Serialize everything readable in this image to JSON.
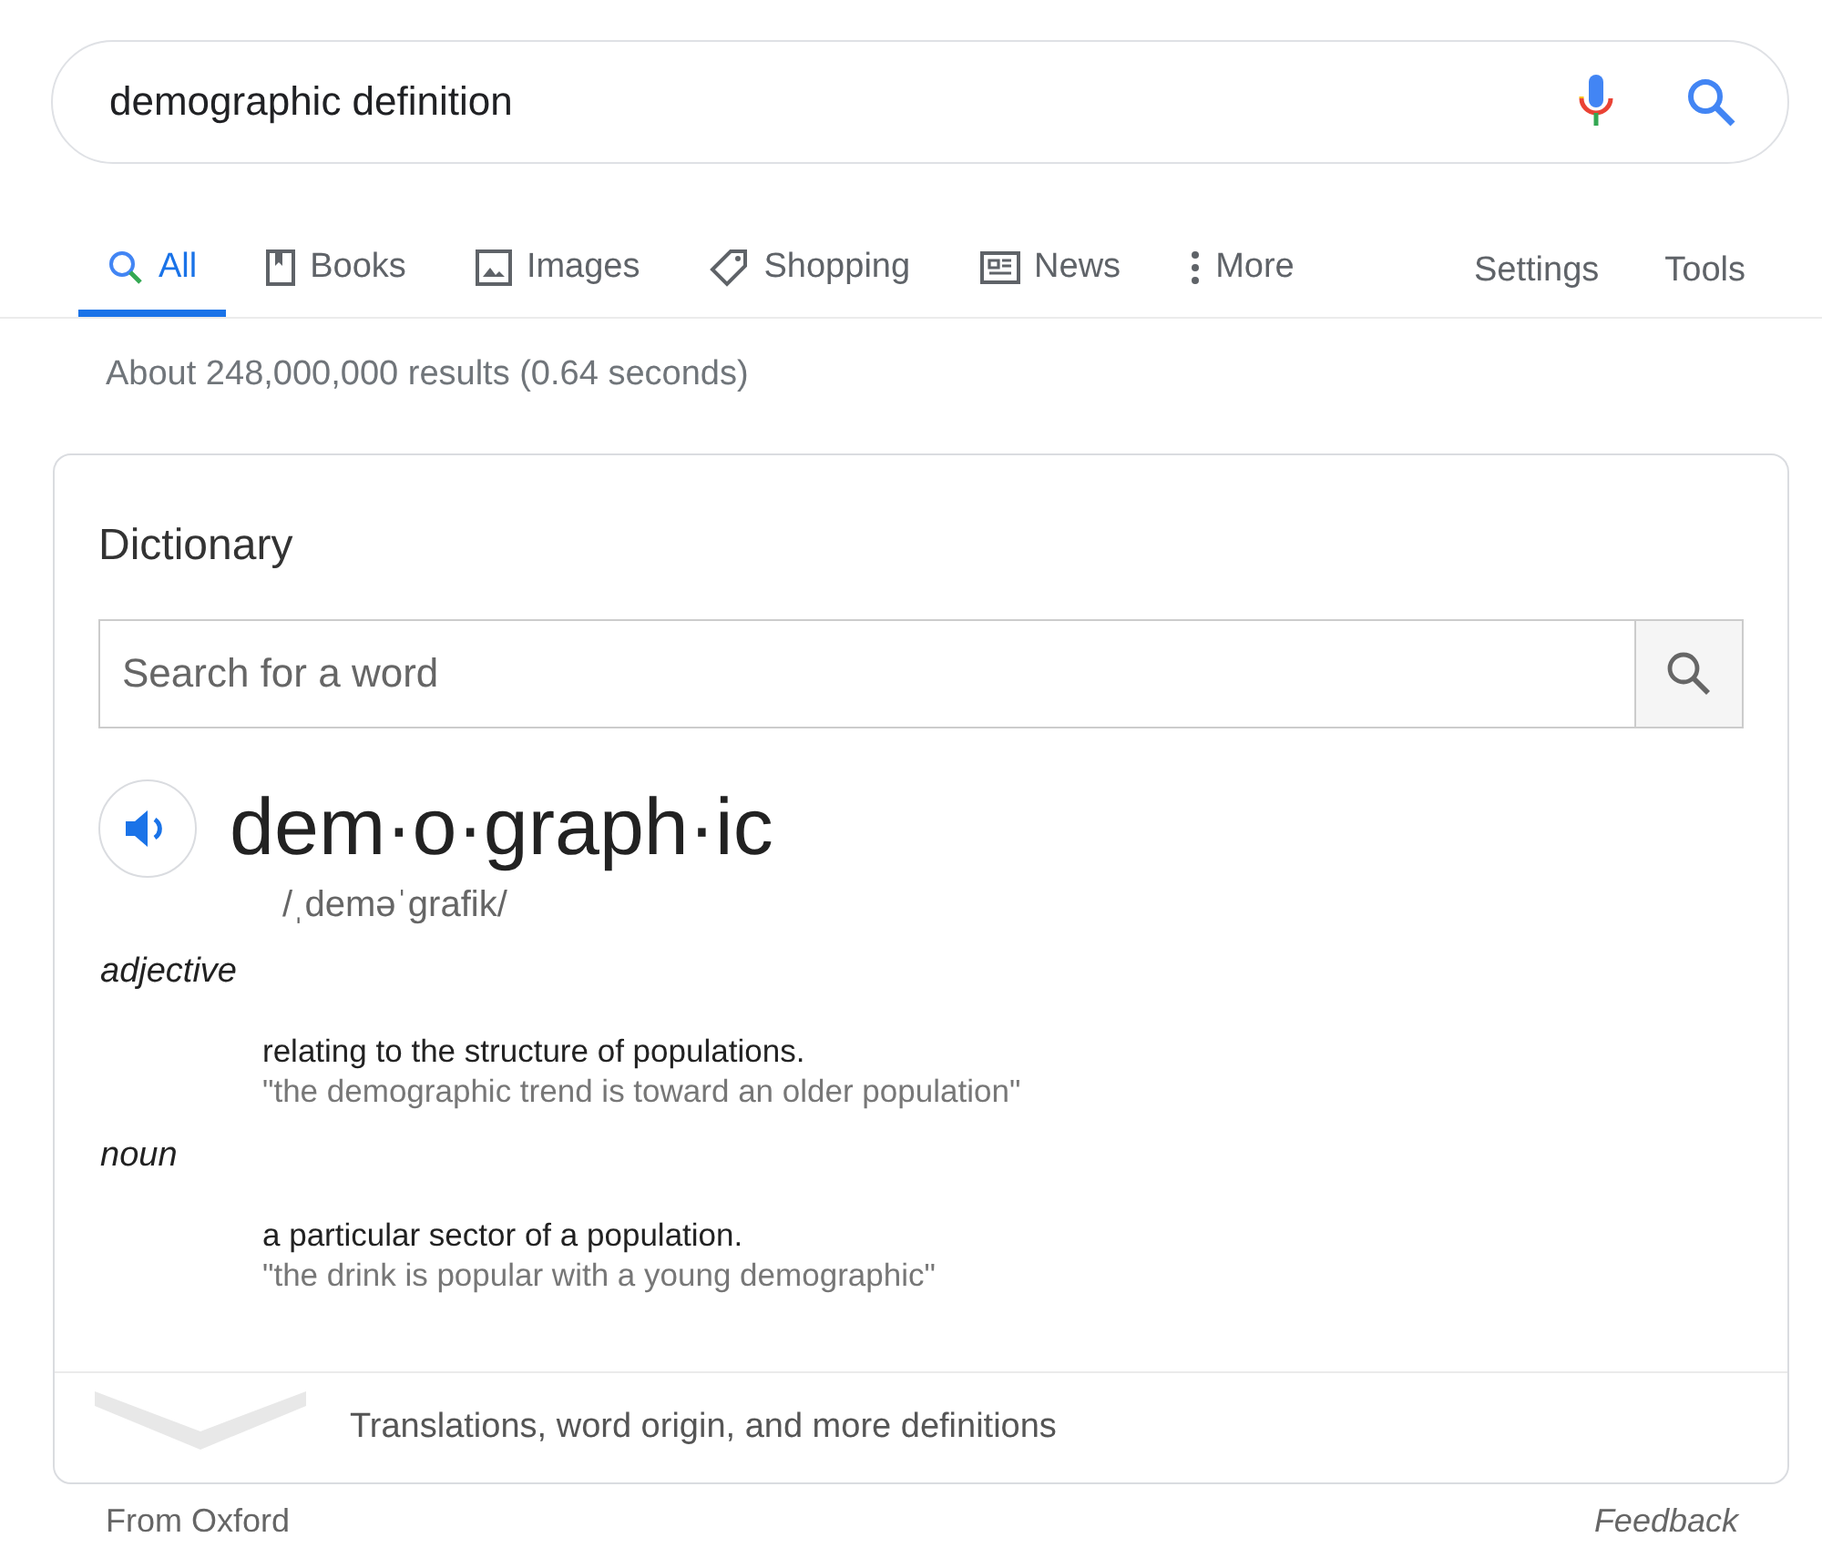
{
  "search": {
    "value": "demographic definition"
  },
  "tabs": [
    {
      "label": "All",
      "kind": "search",
      "selected": true
    },
    {
      "label": "Books",
      "kind": "book",
      "selected": false
    },
    {
      "label": "Images",
      "kind": "image",
      "selected": false
    },
    {
      "label": "Shopping",
      "kind": "tag",
      "selected": false
    },
    {
      "label": "News",
      "kind": "news",
      "selected": false
    },
    {
      "label": "More",
      "kind": "dots",
      "selected": false
    }
  ],
  "tools": [
    "Settings",
    "Tools"
  ],
  "result_stats": "About 248,000,000 results (0.64 seconds)",
  "dictionary": {
    "title": "Dictionary",
    "search": {
      "placeholder": "Search for a word"
    },
    "headword": "dem·o·graph·ic",
    "phonetic": "/ˌdeməˈɡrafik/",
    "senses": [
      {
        "part_of_speech": "adjective",
        "definition": "relating to the structure of populations.",
        "example": "\"the demographic trend is toward an older population\""
      },
      {
        "part_of_speech": "noun",
        "definition": "a particular sector of a population.",
        "example": "\"the drink is popular with a young demographic\""
      }
    ],
    "more": "Translations, word origin, and more definitions"
  },
  "footer": {
    "source": "From Oxford",
    "feedback": "Feedback"
  }
}
